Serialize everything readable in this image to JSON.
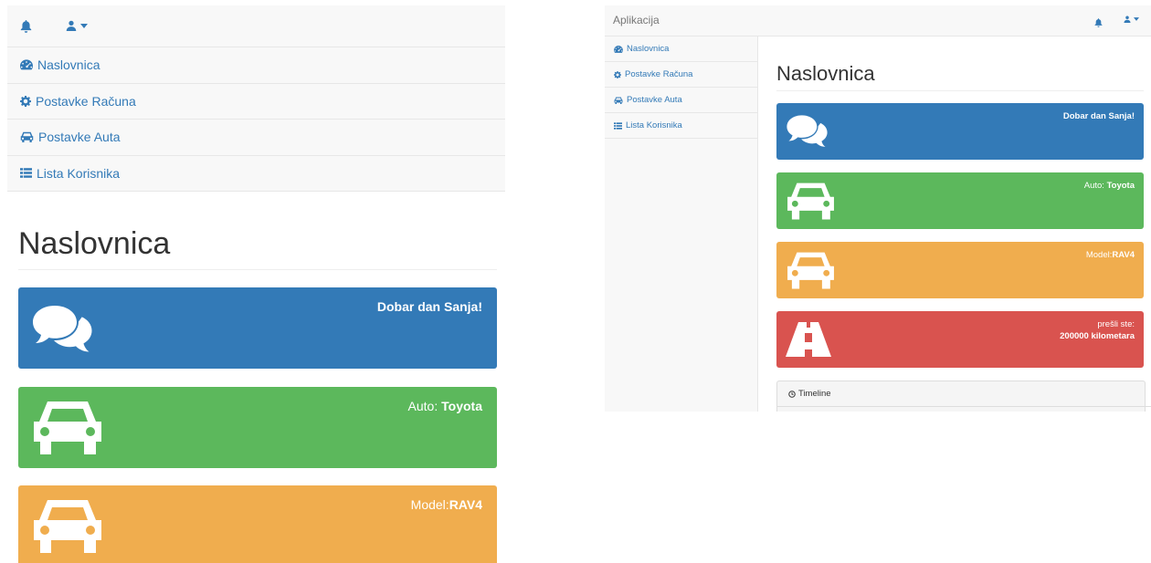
{
  "brand": "Aplikacija",
  "nav": [
    {
      "label": "Naslovnica",
      "icon": "dashboard-icon"
    },
    {
      "label": "Postavke Računa",
      "icon": "gear-icon"
    },
    {
      "label": "Postavke Auta",
      "icon": "car-icon"
    },
    {
      "label": "Lista Korisnika",
      "icon": "list-icon"
    }
  ],
  "page_title": "Naslovnica",
  "panels": {
    "greeting": {
      "text": "Dobar dan Sanja!",
      "color": "#337ab7",
      "icon": "comments-icon"
    },
    "car": {
      "label": "Auto: ",
      "value": "Toyota",
      "color": "#5cb85c",
      "icon": "car-icon"
    },
    "model": {
      "label": "Model:",
      "value": "RAV4",
      "color": "#f0ad4e",
      "icon": "car-icon"
    },
    "distance": {
      "label": "prešli ste:",
      "value": "200000 kilometara",
      "color": "#d9534f",
      "icon": "road-icon"
    }
  },
  "timeline": {
    "label": "Timeline",
    "icon": "clock-icon"
  },
  "colors": {
    "link": "#337ab7",
    "navbar_bg": "#f8f8f8",
    "border": "#e7e7e7"
  }
}
